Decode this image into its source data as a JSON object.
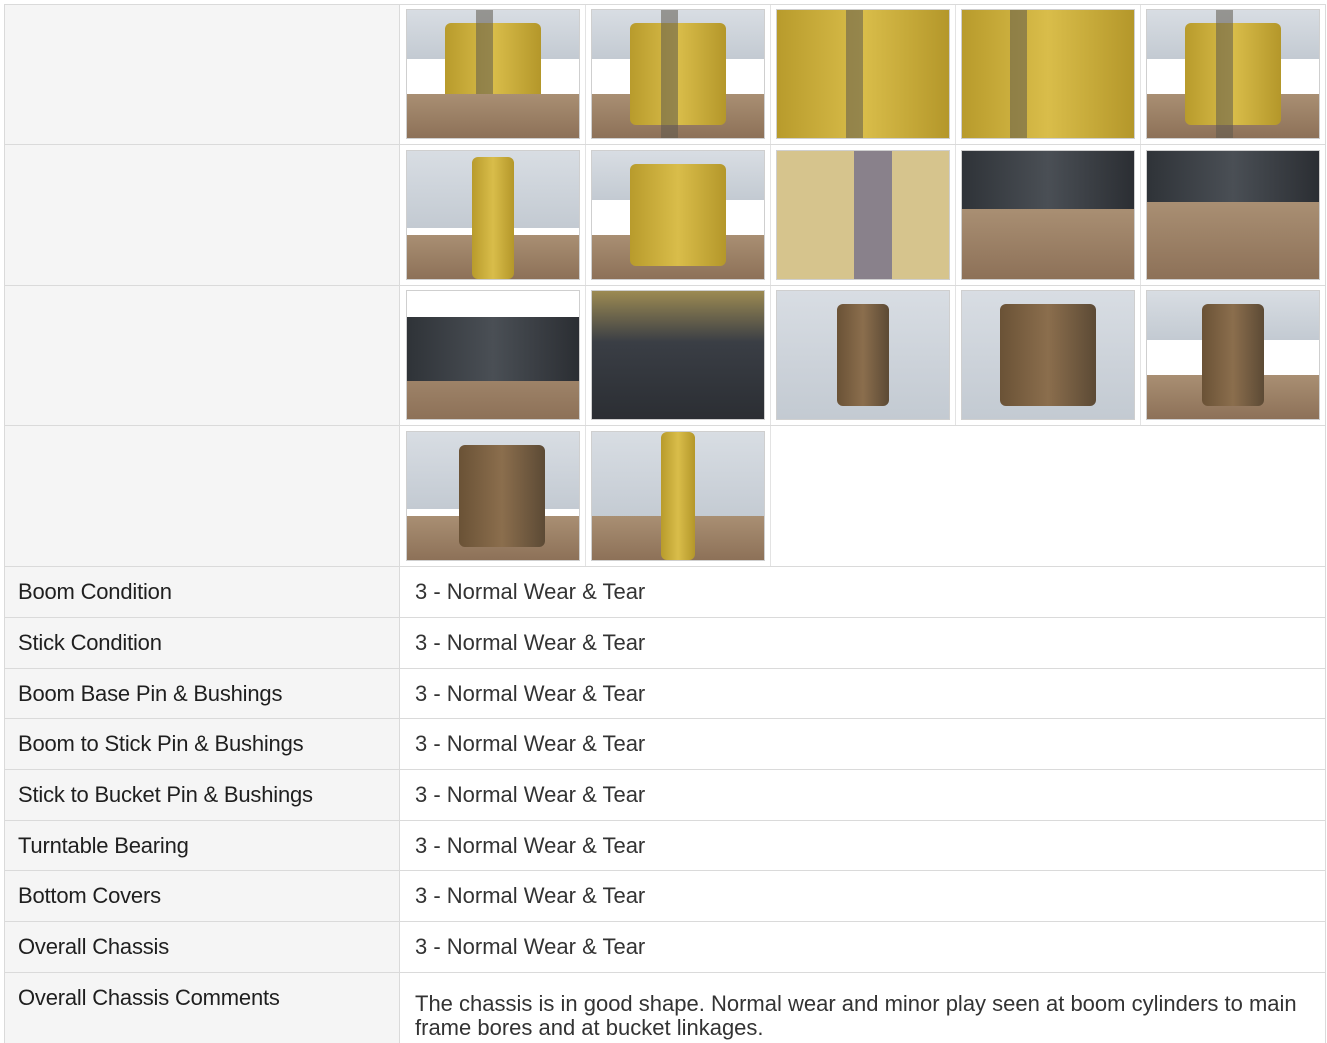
{
  "photo_grid": {
    "rows": [
      {
        "photos": [
          "boom-base-photo",
          "boom-cylinder-photo",
          "boom-pin-photo",
          "boom-hose-photo",
          "boom-cylinder-front-photo"
        ]
      },
      {
        "photos": [
          "boom-upright-photo",
          "cab-side-photo",
          "pin-grease-photo",
          "turntable-bearing-photo",
          "bottom-cover-photo"
        ]
      },
      {
        "photos": [
          "bottom-cover-left-photo",
          "undercarriage-photo",
          "stick-end-photo",
          "stick-bucket-pin-photo",
          "bucket-linkage-photo"
        ]
      },
      {
        "photos": [
          "bucket-linkage-side-photo",
          "boom-front-photo"
        ]
      }
    ]
  },
  "conditions": [
    {
      "label": "Boom Condition",
      "value": "3 - Normal Wear & Tear"
    },
    {
      "label": "Stick Condition",
      "value": "3 - Normal Wear & Tear"
    },
    {
      "label": "Boom Base Pin & Bushings",
      "value": "3 - Normal Wear & Tear"
    },
    {
      "label": "Boom to Stick Pin & Bushings",
      "value": "3 - Normal Wear & Tear"
    },
    {
      "label": "Stick to Bucket Pin & Bushings",
      "value": "3 - Normal Wear & Tear"
    },
    {
      "label": "Turntable Bearing",
      "value": "3 - Normal Wear & Tear"
    },
    {
      "label": "Bottom Covers",
      "value": "3 - Normal Wear & Tear"
    },
    {
      "label": "Overall Chassis",
      "value": "3 - Normal Wear & Tear"
    }
  ],
  "comments": {
    "label": "Overall Chassis Comments",
    "value": "The chassis is in good shape. Normal wear and minor play seen at boom cylinders to main frame bores and at bucket linkages."
  },
  "colors": {
    "label_bg": "#f5f5f5",
    "border": "#dadada",
    "value_bg": "#ffffff"
  }
}
